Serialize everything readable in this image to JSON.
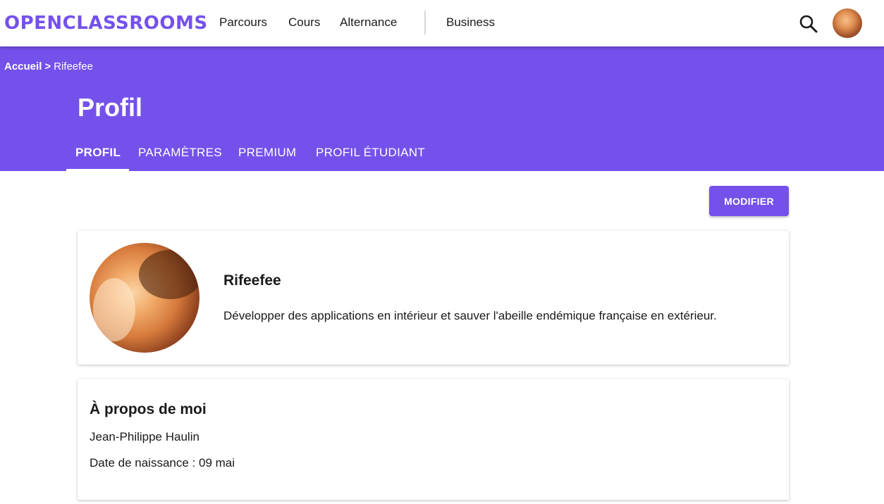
{
  "topnav": {
    "logo": "OPENCLASSROOMS",
    "links": [
      "Parcours",
      "Cours",
      "Alternance",
      "Business"
    ],
    "search_icon": "search-icon",
    "avatar_icon": "user-avatar"
  },
  "breadcrumb": {
    "home": "Accueil",
    "separator": ">",
    "current": "Rifeefee"
  },
  "header": {
    "title": "Profil",
    "tabs": [
      {
        "label": "PROFIL",
        "active": true
      },
      {
        "label": "PARAMÈTRES",
        "active": false
      },
      {
        "label": "PREMIUM",
        "active": false
      },
      {
        "label": "PROFIL ÉTUDIANT",
        "active": false
      }
    ]
  },
  "actions": {
    "edit_label": "MODIFIER"
  },
  "profile": {
    "username": "Rifeefee",
    "bio": "Développer des applications en intérieur et sauver l'abeille endémique française en extérieur."
  },
  "about": {
    "title": "À propos de moi",
    "full_name": "Jean-Philippe Haulin",
    "birth_date": "Date de naissance : 09 mai"
  },
  "colors": {
    "brand": "#7451eb",
    "text": "#1a1a1a",
    "background": "#ffffff"
  }
}
